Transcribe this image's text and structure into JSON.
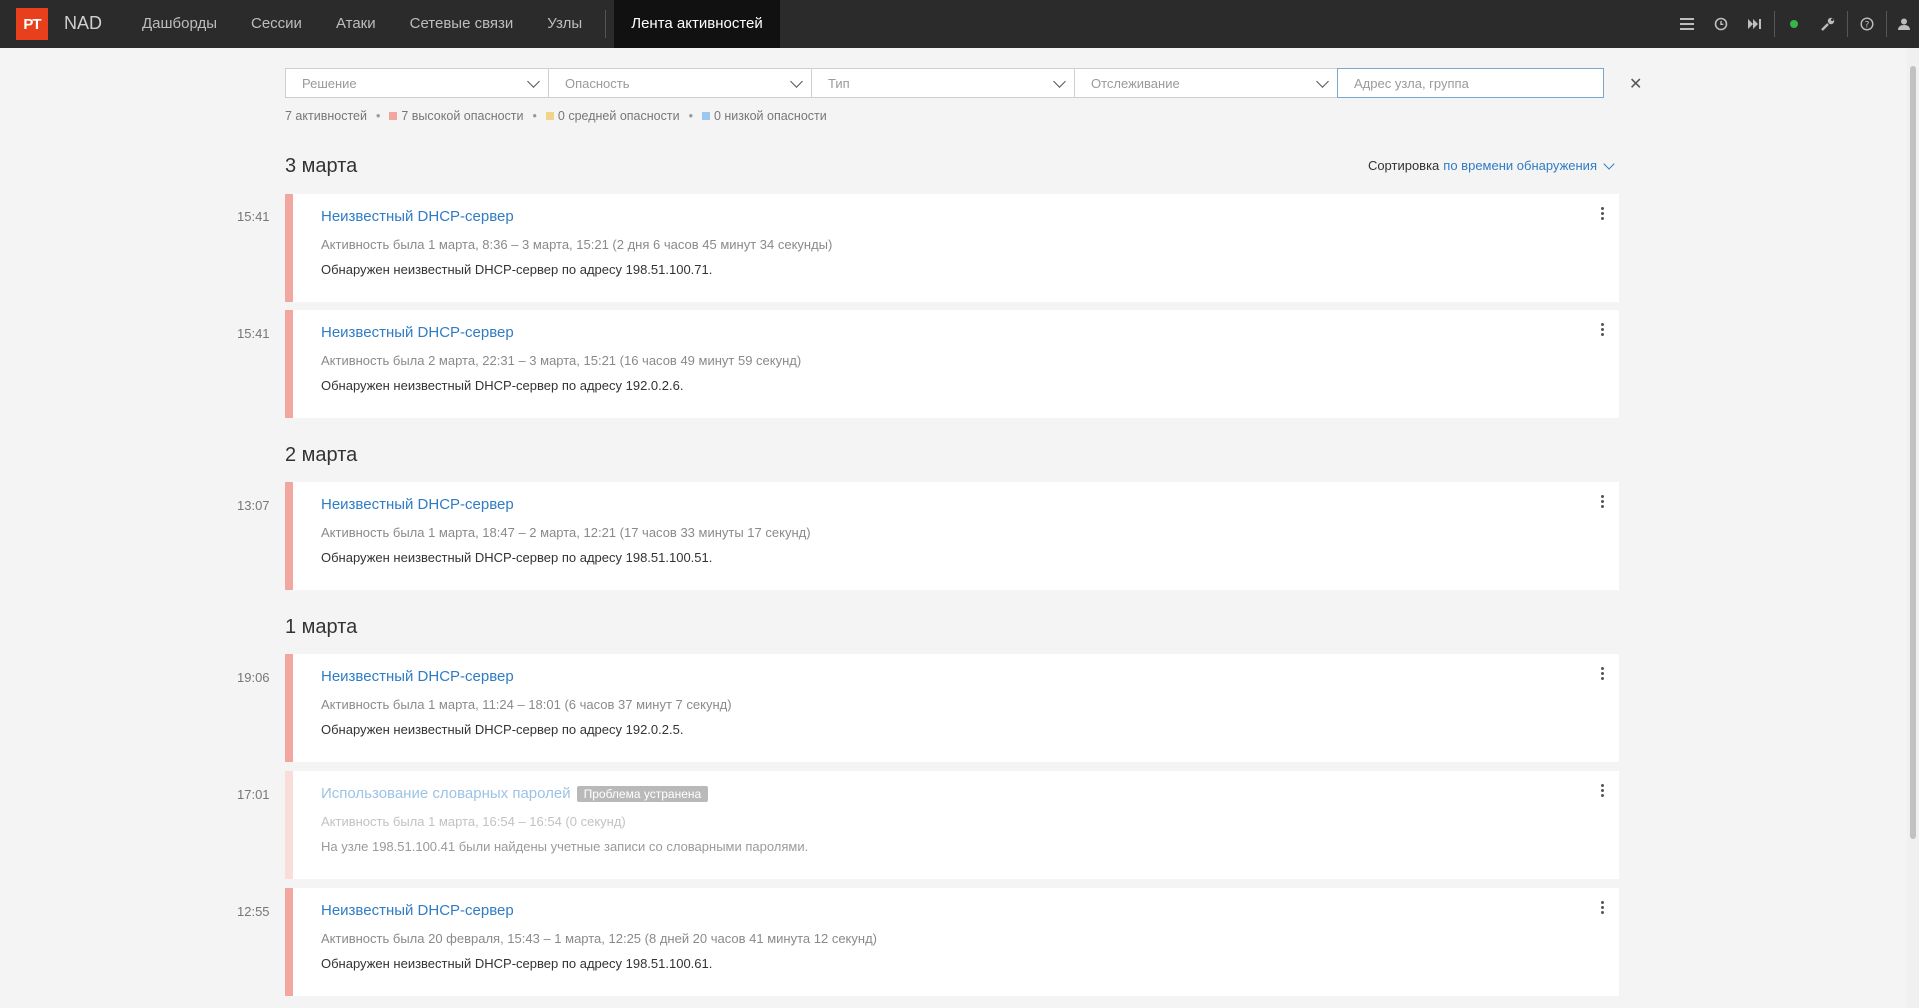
{
  "app": {
    "logo": "PT",
    "product": "NAD"
  },
  "nav": {
    "items": [
      "Дашборды",
      "Сессии",
      "Атаки",
      "Сетевые связи",
      "Узлы"
    ],
    "active": "Лента активностей"
  },
  "top_icons": [
    "menu-icon",
    "clock-icon",
    "fast-forward-icon",
    "status-dot-icon",
    "wrench-icon",
    "help-icon"
  ],
  "colors": {
    "accent": "#2f7cc5",
    "high": "#f3a69f",
    "medium": "#f2d38b",
    "low": "#9cc8f0",
    "status_ok": "#38b54a",
    "logo": "#e8401c"
  },
  "filters": {
    "decision": "Решение",
    "severity": "Опасность",
    "type": "Тип",
    "tracking": "Отслеживание",
    "search_placeholder": "Адрес узла, группа"
  },
  "summary": {
    "total": "7 активностей",
    "high": "7 высокой опасности",
    "medium": "0 средней опасности",
    "low": "0 низкой опасности"
  },
  "sort": {
    "label": "Сортировка",
    "value": "по времени обнаружения"
  },
  "groups": [
    {
      "date": "3 марта"
    },
    {
      "date": "2 марта"
    },
    {
      "date": "1 марта"
    }
  ],
  "activities": [
    {
      "time": "15:41",
      "title": "Неизвестный DHCP-сервер",
      "active": "Активность была 1 марта, 8:36 – 3 марта, 15:21 (2 дня 6 часов 45 минут 34 секунды)",
      "desc": "Обнаружен неизвестный DHCP-сервер по адресу 198.51.100.71."
    },
    {
      "time": "15:41",
      "title": "Неизвестный DHCP-сервер",
      "active": "Активность была 2 марта, 22:31 – 3 марта, 15:21 (16 часов 49 минут 59 секунд)",
      "desc": "Обнаружен неизвестный DHCP-сервер по адресу 192.0.2.6."
    },
    {
      "time": "13:07",
      "title": "Неизвестный DHCP-сервер",
      "active": "Активность была 1 марта, 18:47 – 2 марта, 12:21 (17 часов 33 минуты 17 секунд)",
      "desc": "Обнаружен неизвестный DHCP-сервер по адресу 198.51.100.51."
    },
    {
      "time": "19:06",
      "title": "Неизвестный DHCP-сервер",
      "active": "Активность была 1 марта, 11:24 – 18:01 (6 часов 37 минут 7 секунд)",
      "desc": "Обнаружен неизвестный DHCP-сервер по адресу 192.0.2.5."
    },
    {
      "time": "17:01",
      "title": "Использование словарных паролей",
      "badge": "Проблема устранена",
      "active": "Активность была 1 марта, 16:54 – 16:54 (0 секунд)",
      "desc": "На узле 198.51.100.41 были найдены учетные записи со словарными паролями."
    },
    {
      "time": "12:55",
      "title": "Неизвестный DHCP-сервер",
      "active": "Активность была 20 февраля, 15:43 – 1 марта, 12:25 (8 дней 20 часов 41 минута 12 секунд)",
      "desc": "Обнаружен неизвестный DHCP-сервер по адресу 198.51.100.61."
    }
  ]
}
